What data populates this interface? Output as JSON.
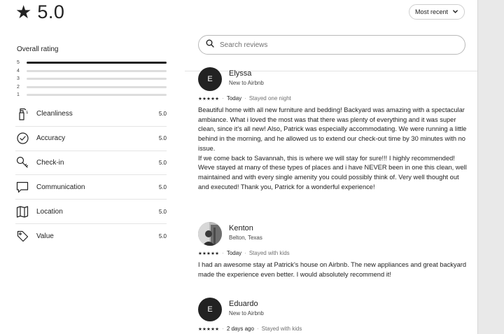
{
  "header": {
    "star_glyph": "★",
    "rating": "5.0",
    "sort_label": "Most recent"
  },
  "overall": {
    "title": "Overall rating",
    "bars": [
      {
        "label": "5",
        "fraction": 1.0
      },
      {
        "label": "4",
        "fraction": 0.0
      },
      {
        "label": "3",
        "fraction": 0.0
      },
      {
        "label": "2",
        "fraction": 0.0
      },
      {
        "label": "1",
        "fraction": 0.0
      }
    ]
  },
  "categories": [
    {
      "label": "Cleanliness",
      "score": "5.0",
      "icon": "spray-bottle-icon"
    },
    {
      "label": "Accuracy",
      "score": "5.0",
      "icon": "check-circle-icon"
    },
    {
      "label": "Check-in",
      "score": "5.0",
      "icon": "key-icon"
    },
    {
      "label": "Communication",
      "score": "5.0",
      "icon": "chat-bubble-icon"
    },
    {
      "label": "Location",
      "score": "5.0",
      "icon": "map-icon"
    },
    {
      "label": "Value",
      "score": "5.0",
      "icon": "tag-icon"
    }
  ],
  "search": {
    "placeholder": "Search reviews"
  },
  "reviews": [
    {
      "initial": "E",
      "name": "Elyssa",
      "subtitle": "New to Airbnb",
      "stars": "★★★★★",
      "date": "Today",
      "stay": "Stayed one night",
      "paragraphs": [
        "Beautiful home with all new furniture and bedding! Backyard was amazing with a spectacular ambiance. What i loved the most was that there was plenty of everything and it was super clean, since it's all new! Also, Patrick was especially accommodating. We were running a little behind in the morning, and he allowed us to extend our check-out time by 30 minutes with no issue.",
        "If we come back to Savannah, this is where we will stay for sure!!! I highly recommended! Weve stayed at many of these types of places and i have NEVER been in one this clean, well maintained and with every single amenity you could possibly think of. Very well thought out and executed! Thank you, Patrick for a wonderful experience!"
      ]
    },
    {
      "initial": "",
      "name": "Kenton",
      "subtitle": "Belton, Texas",
      "stars": "★★★★★",
      "date": "Today",
      "stay": "Stayed with kids",
      "paragraphs": [
        "I had an awesome stay at Patrick's house on Airbnb. The new appliances and great backyard made the experience even better. I would absolutely recommend it!"
      ]
    },
    {
      "initial": "E",
      "name": "Eduardo",
      "subtitle": "New to Airbnb",
      "stars": "★★★★★",
      "date": "2 days ago",
      "stay": "Stayed with kids",
      "paragraphs": []
    }
  ]
}
